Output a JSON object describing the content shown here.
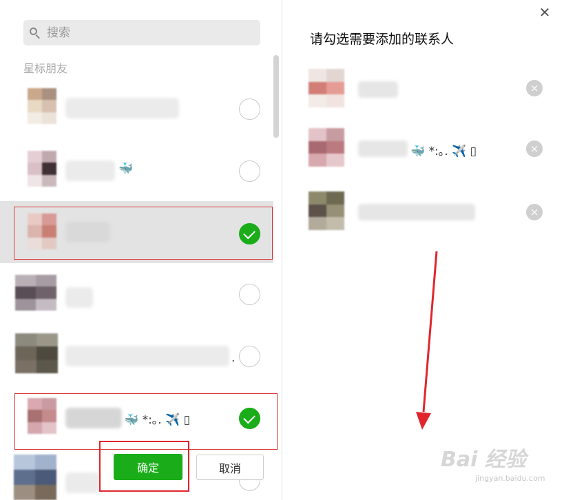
{
  "search": {
    "placeholder": "搜索"
  },
  "section_label": "星标朋友",
  "contacts": [
    {
      "checked": false,
      "emoji": "",
      "highlighted": false
    },
    {
      "checked": false,
      "emoji": "🐳",
      "highlighted": false
    },
    {
      "checked": true,
      "emoji": "",
      "highlighted": true
    },
    {
      "checked": false,
      "emoji": "",
      "highlighted": false
    },
    {
      "checked": false,
      "emoji": ".",
      "highlighted": false
    },
    {
      "checked": true,
      "emoji": "🐳 *:｡. ✈️ ▯",
      "highlighted": true
    },
    {
      "checked": false,
      "emoji": "",
      "highlighted": false
    }
  ],
  "right_panel": {
    "title": "请勾选需要添加的联系人",
    "close_icon": "close-icon",
    "selected": [
      {
        "emoji": ""
      },
      {
        "emoji": "🐳 *:｡. ✈️ ▯"
      },
      {
        "emoji": ""
      }
    ],
    "remove_label": "×"
  },
  "buttons": {
    "confirm": "确定",
    "cancel": "取消"
  },
  "watermark": {
    "main": "Bai 经验",
    "sub": "jingyan.baidu.com"
  },
  "colors": {
    "accent": "#1aad19",
    "highlight": "#e0262d"
  }
}
